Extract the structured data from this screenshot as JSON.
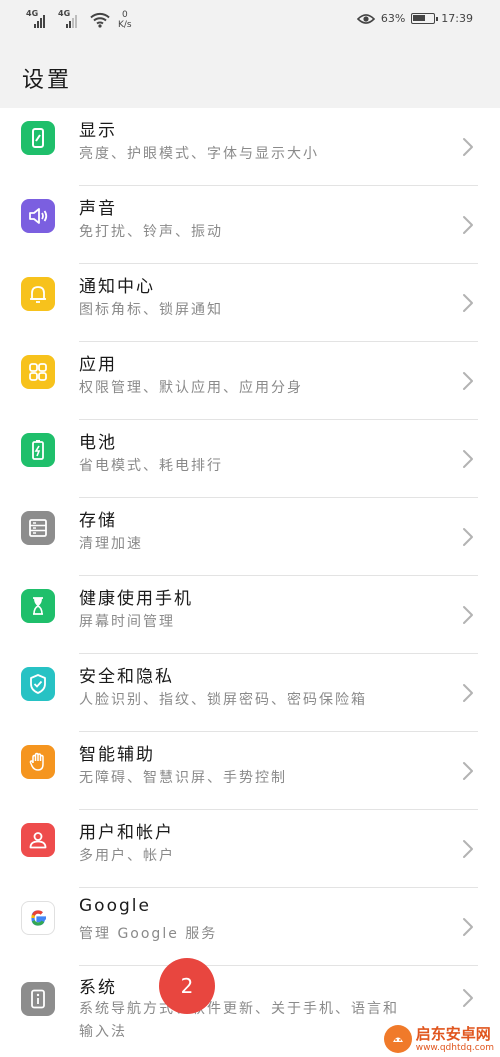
{
  "status_bar": {
    "sim1_tag": "4G",
    "sim2_tag": "4G",
    "net_speed_value": "0",
    "net_speed_unit": "K/s",
    "battery_percent": "63%",
    "battery_level": 0.63,
    "time": "17:39",
    "icons": [
      "signal-icon",
      "signal-icon",
      "wifi-icon",
      "eye-comfort-icon",
      "battery-icon"
    ]
  },
  "header": {
    "title": "设置"
  },
  "settings": [
    {
      "title": "显示",
      "subtitle": "亮度、护眼模式、字体与显示大小",
      "icon": "display-icon",
      "color": "#1fbf6b"
    },
    {
      "title": "声音",
      "subtitle": "免打扰、铃声、振动",
      "icon": "sound-icon",
      "color": "#7b5fe0"
    },
    {
      "title": "通知中心",
      "subtitle": "图标角标、锁屏通知",
      "icon": "bell-icon",
      "color": "#f7c21c"
    },
    {
      "title": "应用",
      "subtitle": "权限管理、默认应用、应用分身",
      "icon": "apps-icon",
      "color": "#f7c21c"
    },
    {
      "title": "电池",
      "subtitle": "省电模式、耗电排行",
      "icon": "battery-icon",
      "color": "#1fbf6b"
    },
    {
      "title": "存储",
      "subtitle": "清理加速",
      "icon": "storage-icon",
      "color": "#8d8d8d"
    },
    {
      "title": "健康使用手机",
      "subtitle": "屏幕时间管理",
      "icon": "hourglass-icon",
      "color": "#1fbf6b"
    },
    {
      "title": "安全和隐私",
      "subtitle": "人脸识别、指纹、锁屏密码、密码保险箱",
      "icon": "shield-icon",
      "color": "#27c2c4"
    },
    {
      "title": "智能辅助",
      "subtitle": "无障碍、智慧识屏、手势控制",
      "icon": "hand-icon",
      "color": "#f5951f"
    },
    {
      "title": "用户和帐户",
      "subtitle": "多用户、帐户",
      "icon": "user-icon",
      "color": "#ee4c4c"
    },
    {
      "title": "Google",
      "subtitle": "管理 Google 服务",
      "icon": "google-icon",
      "color": "#ffffff"
    },
    {
      "title": "系统",
      "subtitle": "系统导航方式、软件更新、关于手机、语言和",
      "subtitle2": "输入法",
      "icon": "system-icon",
      "color": "#8d8d8d"
    }
  ],
  "annotation_badge": "2",
  "watermark": {
    "name": "启东安卓网",
    "url": "www.qdhtdq.com"
  }
}
